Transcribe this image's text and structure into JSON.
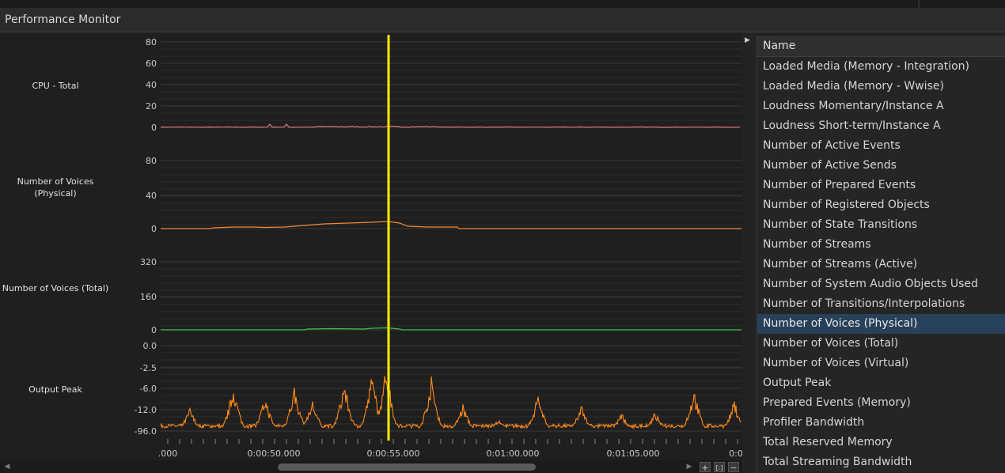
{
  "window": {
    "title": "Performance Monitor"
  },
  "graph": {
    "lanes": [
      {
        "id": "cpu",
        "label": "CPU - Total",
        "ticks": [
          "80",
          "60",
          "40",
          "20",
          "0"
        ],
        "color": "#e07a78"
      },
      {
        "id": "phys",
        "label": "Number of Voices\n(Physical)",
        "ticks": [
          "80",
          "40",
          "0"
        ],
        "color": "#f08a3a"
      },
      {
        "id": "total",
        "label": "Number of Voices (Total)",
        "ticks": [
          "320",
          "160",
          "0"
        ],
        "color": "#3ec24a"
      },
      {
        "id": "peak",
        "label": "Output Peak",
        "ticks": [
          "0.0",
          "-2.5",
          "-6.0",
          "-12.0",
          "-96.0"
        ],
        "color": "#ff8a1a"
      }
    ],
    "time_labels": [
      ".000",
      "0:00:50.000",
      "0:00:55.000",
      "0:01:00.000",
      "0:01:05.000",
      "0:0"
    ],
    "cursor_color": "#ffee00",
    "cursor_time": "0:00:55.000"
  },
  "toolbar": {
    "zoom_in": "+",
    "zoom_fit": "[:]",
    "zoom_out": "−"
  },
  "side_panel": {
    "header": "Name",
    "selected_index": 13,
    "items": [
      "Loaded Media (Memory - Integration)",
      "Loaded Media (Memory - Wwise)",
      "Loudness Momentary/Instance A",
      "Loudness Short-term/Instance A",
      "Number of Active Events",
      "Number of Active Sends",
      "Number of Prepared Events",
      "Number of Registered Objects",
      "Number of State Transitions",
      "Number of Streams",
      "Number of Streams (Active)",
      "Number of System Audio Objects Used",
      "Number of Transitions/Interpolations",
      "Number of Voices (Physical)",
      "Number of Voices (Total)",
      "Number of Voices (Virtual)",
      "Output Peak",
      "Prepared Events (Memory)",
      "Profiler Bandwidth",
      "Total Reserved Memory",
      "Total Streaming Bandwidth"
    ]
  }
}
